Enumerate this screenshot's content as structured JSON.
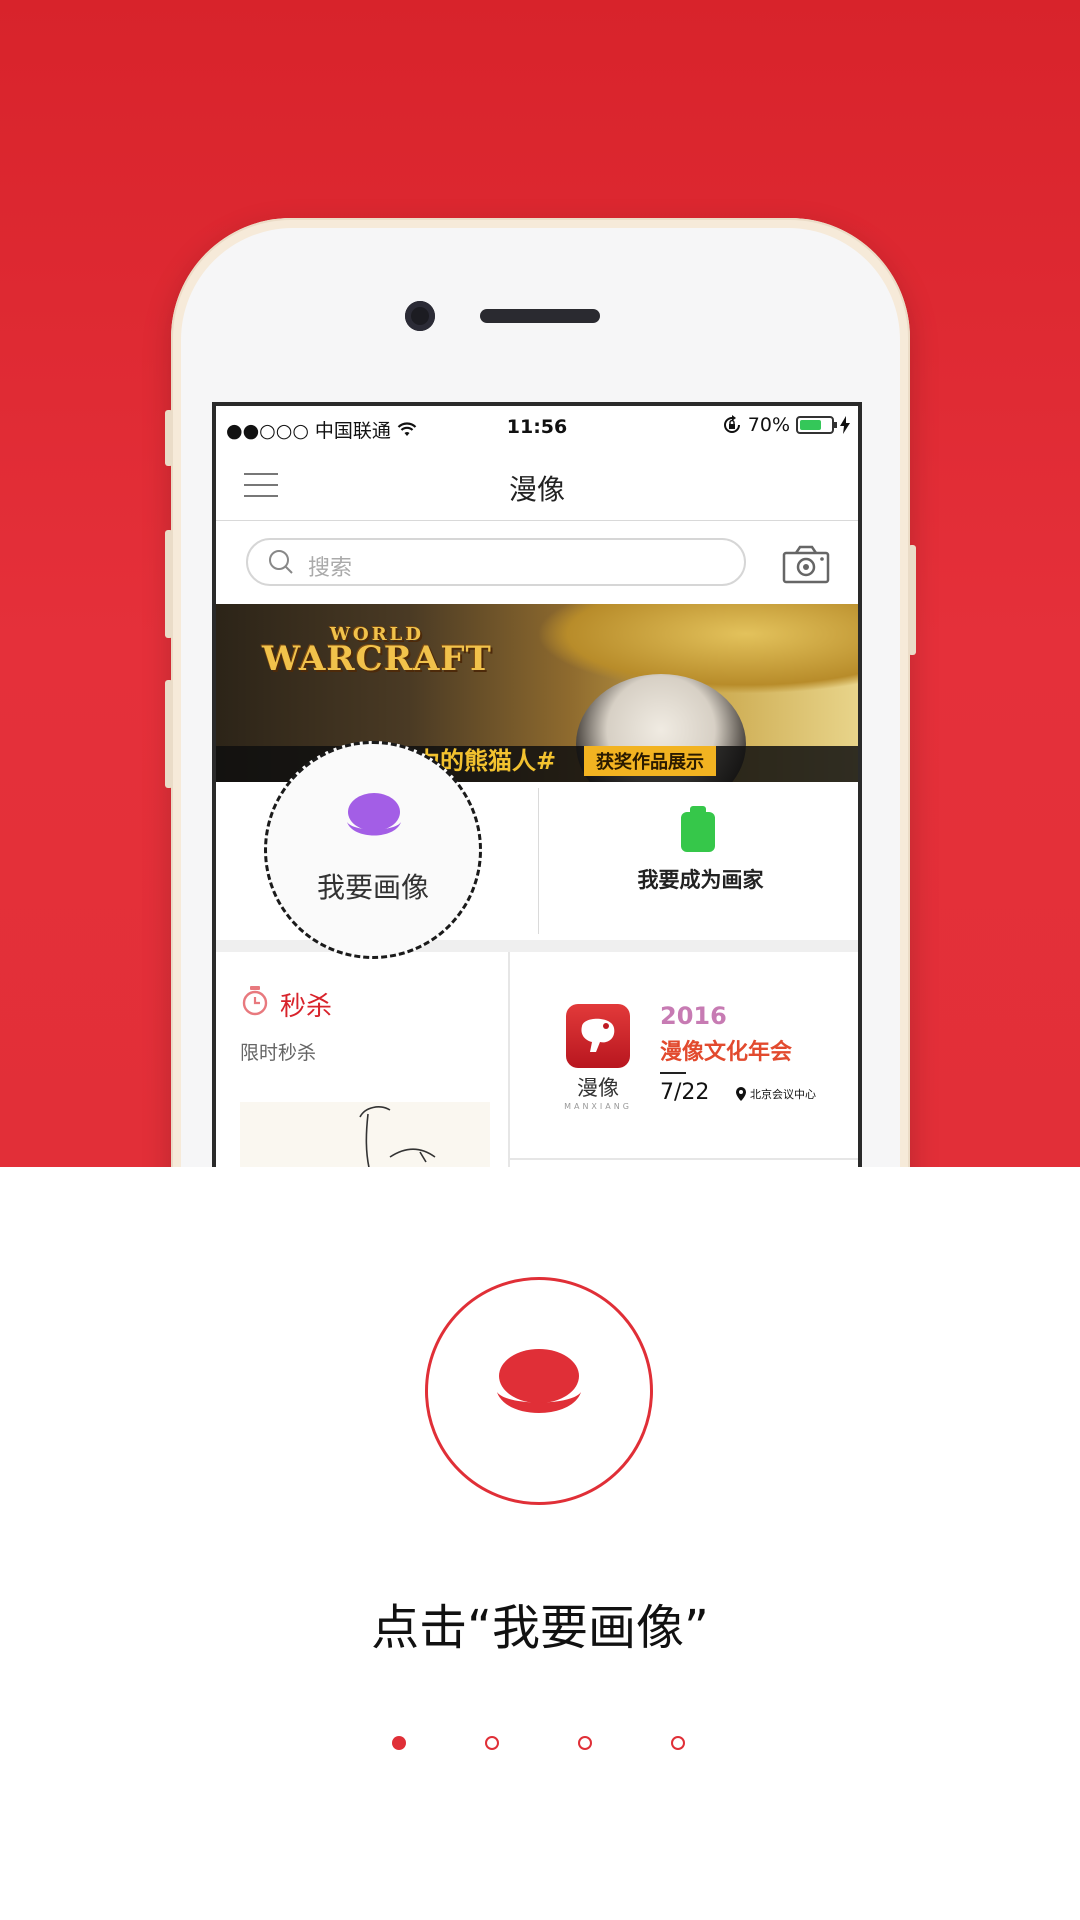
{
  "status_bar": {
    "carrier": "●●○○○ 中国联通",
    "time": "11:56",
    "battery": "70%",
    "battery_level": 0.7
  },
  "nav": {
    "title": "漫像"
  },
  "search": {
    "placeholder": "搜索"
  },
  "banner": {
    "logo_line1": "WORLD",
    "logo_line2": "WARCRAFT",
    "tag": "力的熊猫人#",
    "badge": "获奖作品展示"
  },
  "actions": {
    "draw_me": "我要画像",
    "become_artist": "我要成为画家"
  },
  "seckill": {
    "title": "秒杀",
    "subtitle": "限时秒杀"
  },
  "event": {
    "logo_text": "漫像",
    "logo_sub": "MANXIANG",
    "year": "2016",
    "name": "漫像文化年会",
    "date": "7/22",
    "place": "北京会议中心"
  },
  "caption": "点击“我要画像”",
  "pager": {
    "total": 4,
    "active": 0
  },
  "colors": {
    "brand_red": "#e02f37",
    "accent_purple": "#a35ee6",
    "accent_green": "#36c74a"
  }
}
